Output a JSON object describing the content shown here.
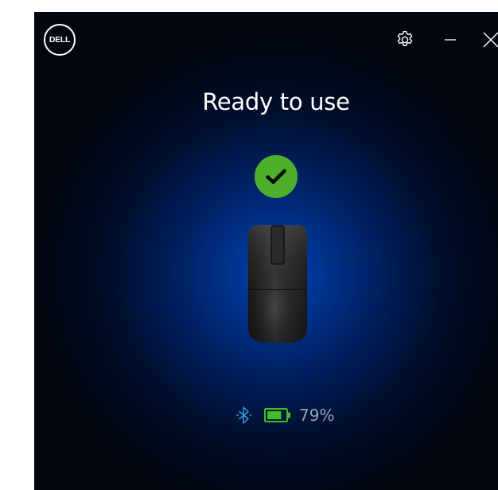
{
  "app": {
    "logo_text": "DELL",
    "title": "Ready to use"
  },
  "window_controls": {
    "settings_icon": "gear-icon",
    "minimize_icon": "minimize-icon",
    "close_icon": "close-icon"
  },
  "device": {
    "type": "mouse",
    "status_icon": "check-circle-icon",
    "connection_icon": "bluetooth-icon",
    "battery_level": 0.79,
    "battery_text": "79%"
  },
  "colors": {
    "success": "#4caf2a",
    "bluetooth": "#2f9bdc",
    "battery": "#3fbf22",
    "text_muted": "#9aa3ad"
  }
}
